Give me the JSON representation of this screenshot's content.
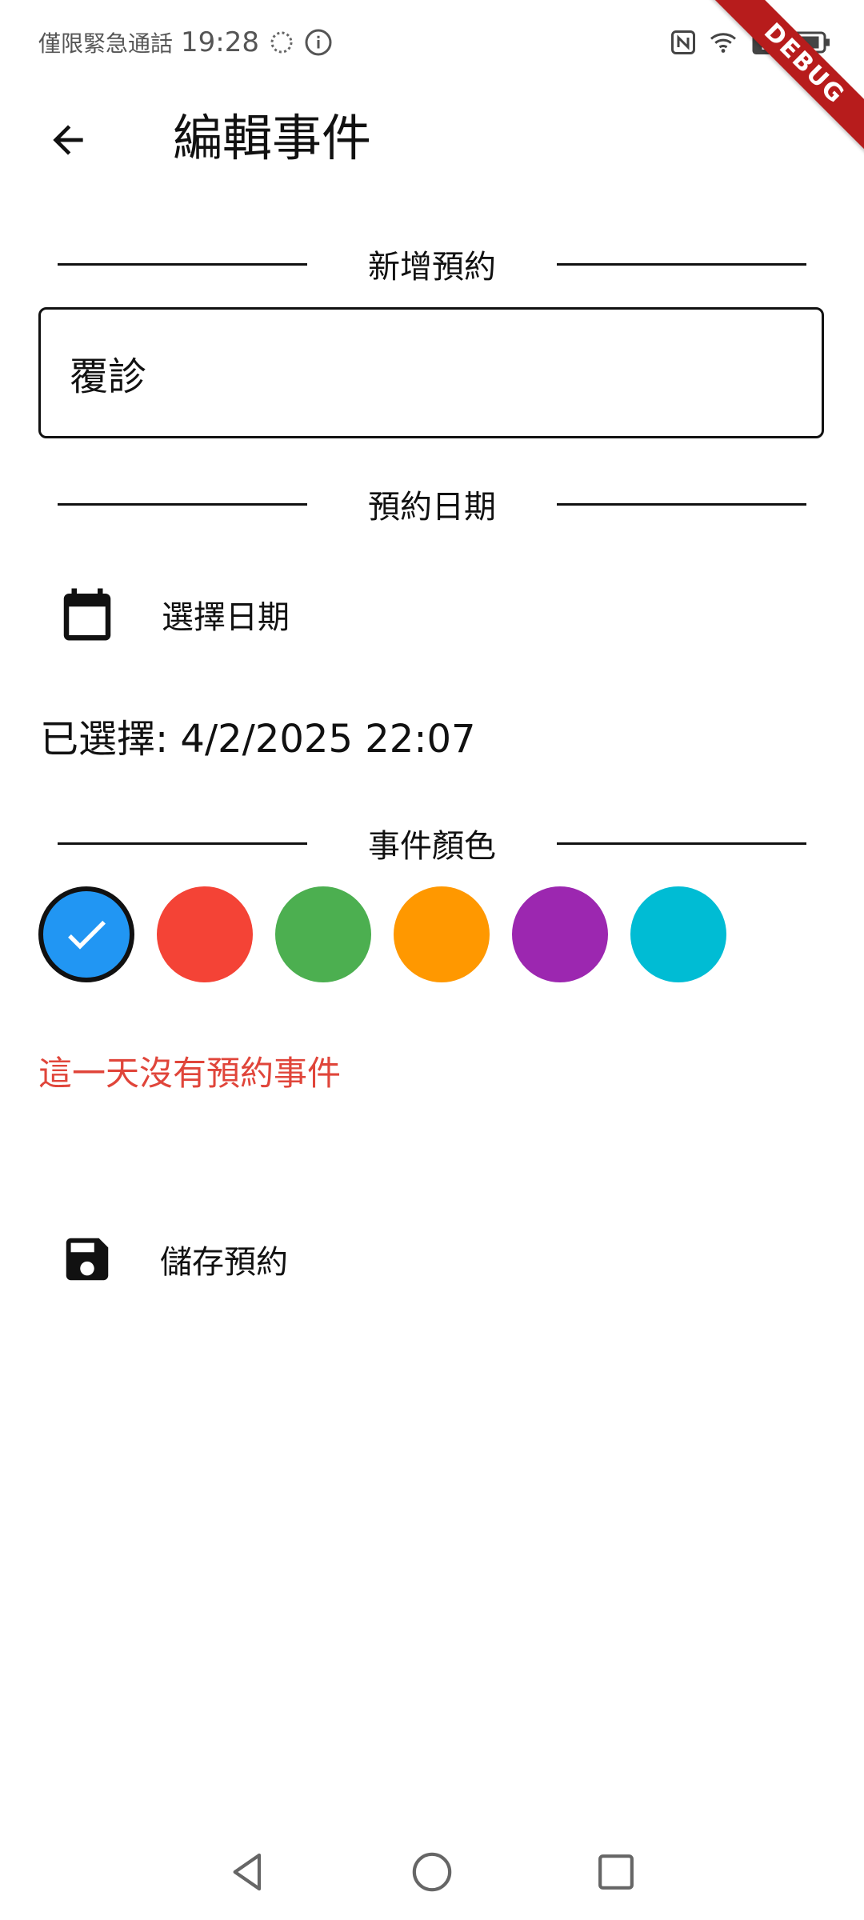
{
  "status_bar": {
    "carrier": "僅限緊急通話",
    "time": "19:28"
  },
  "debug_banner": "DEBUG",
  "app_bar": {
    "title": "編輯事件"
  },
  "sections": {
    "new_appointment": "新增預約",
    "appointment_date": "預約日期",
    "event_color": "事件顏色"
  },
  "event_name": {
    "value": "覆診"
  },
  "select_date_label": "選擇日期",
  "selected_date_text": "已選擇: 4/2/2025 22:07",
  "colors": [
    {
      "hex": "#2196f3",
      "selected": true
    },
    {
      "hex": "#f44336",
      "selected": false
    },
    {
      "hex": "#4caf50",
      "selected": false
    },
    {
      "hex": "#ff9800",
      "selected": false
    },
    {
      "hex": "#9c27b0",
      "selected": false
    },
    {
      "hex": "#00bcd4",
      "selected": false
    }
  ],
  "no_events_message": "這一天沒有預約事件",
  "save_label": "儲存預約",
  "accent_colors": {
    "warning_text": "#e0453a",
    "debug_banner": "#b71c1c"
  }
}
